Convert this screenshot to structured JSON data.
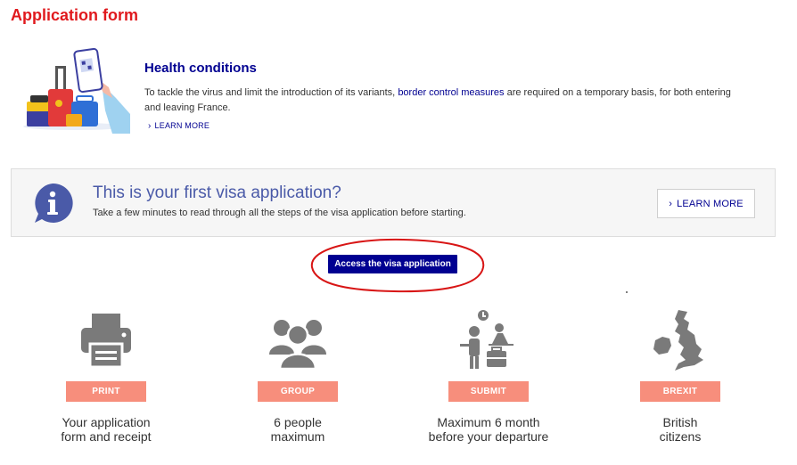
{
  "page": {
    "title": "Application form"
  },
  "health": {
    "title": "Health conditions",
    "text_before": "To tackle the virus and limit the introduction of its variants, ",
    "link_text": "border control measures",
    "text_after": " are required on a temporary basis, for both entering and leaving France.",
    "learn_more": "LEARN MORE"
  },
  "visa_box": {
    "title": "This is your first visa application?",
    "subtitle": "Take a few minutes to read through all the steps of the visa application before starting.",
    "learn_more": "LEARN MORE"
  },
  "access": {
    "label": "Access the visa application"
  },
  "features": [
    {
      "icon": "printer-icon",
      "badge": "PRINT",
      "line1": "Your application",
      "line2": "form and receipt"
    },
    {
      "icon": "people-icon",
      "badge": "GROUP",
      "line1": "6 people",
      "line2": "maximum"
    },
    {
      "icon": "traveler-clock-icon",
      "badge": "SUBMIT",
      "line1": "Maximum 6 month",
      "line2": "before your departure"
    },
    {
      "icon": "uk-map-icon",
      "badge": "BREXIT",
      "line1": "British",
      "line2": "citizens"
    }
  ],
  "colors": {
    "brand_red": "#e0191d",
    "navy": "#000091",
    "badge_salmon": "#f78e7c",
    "icon_gray": "#7a7a7a"
  }
}
